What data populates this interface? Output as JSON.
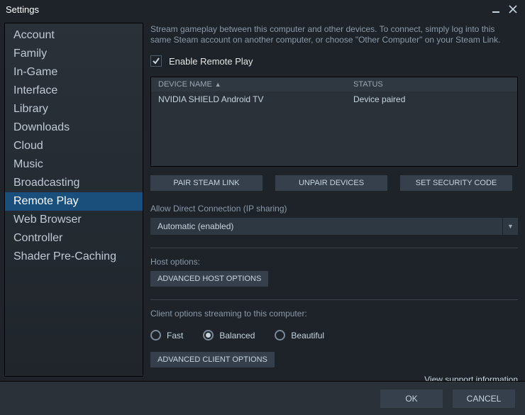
{
  "window": {
    "title": "Settings"
  },
  "sidebar": {
    "items": [
      "Account",
      "Family",
      "In-Game",
      "Interface",
      "Library",
      "Downloads",
      "Cloud",
      "Music",
      "Broadcasting",
      "Remote Play",
      "Web Browser",
      "Controller",
      "Shader Pre-Caching"
    ],
    "active_index": 9
  },
  "main": {
    "description": "Stream gameplay between this computer and other devices. To connect, simply log into this same Steam account on another computer, or choose \"Other Computer\" on your Steam Link.",
    "enable_checkbox": {
      "label": "Enable Remote Play",
      "checked": true
    },
    "device_table": {
      "headers": {
        "name": "DEVICE NAME",
        "status": "STATUS"
      },
      "rows": [
        {
          "name": "NVIDIA SHIELD Android TV",
          "status": "Device paired"
        }
      ]
    },
    "buttons": {
      "pair": "PAIR STEAM LINK",
      "unpair": "UNPAIR DEVICES",
      "security": "SET SECURITY CODE"
    },
    "direct_connection": {
      "label": "Allow Direct Connection (IP sharing)",
      "value": "Automatic (enabled)"
    },
    "host": {
      "label": "Host options:",
      "advanced": "ADVANCED HOST OPTIONS"
    },
    "client": {
      "label": "Client options streaming to this computer:",
      "options": [
        {
          "label": "Fast",
          "selected": false
        },
        {
          "label": "Balanced",
          "selected": true
        },
        {
          "label": "Beautiful",
          "selected": false
        }
      ],
      "advanced": "ADVANCED CLIENT OPTIONS"
    },
    "support_link": "View support information"
  },
  "footer": {
    "ok": "OK",
    "cancel": "CANCEL"
  }
}
